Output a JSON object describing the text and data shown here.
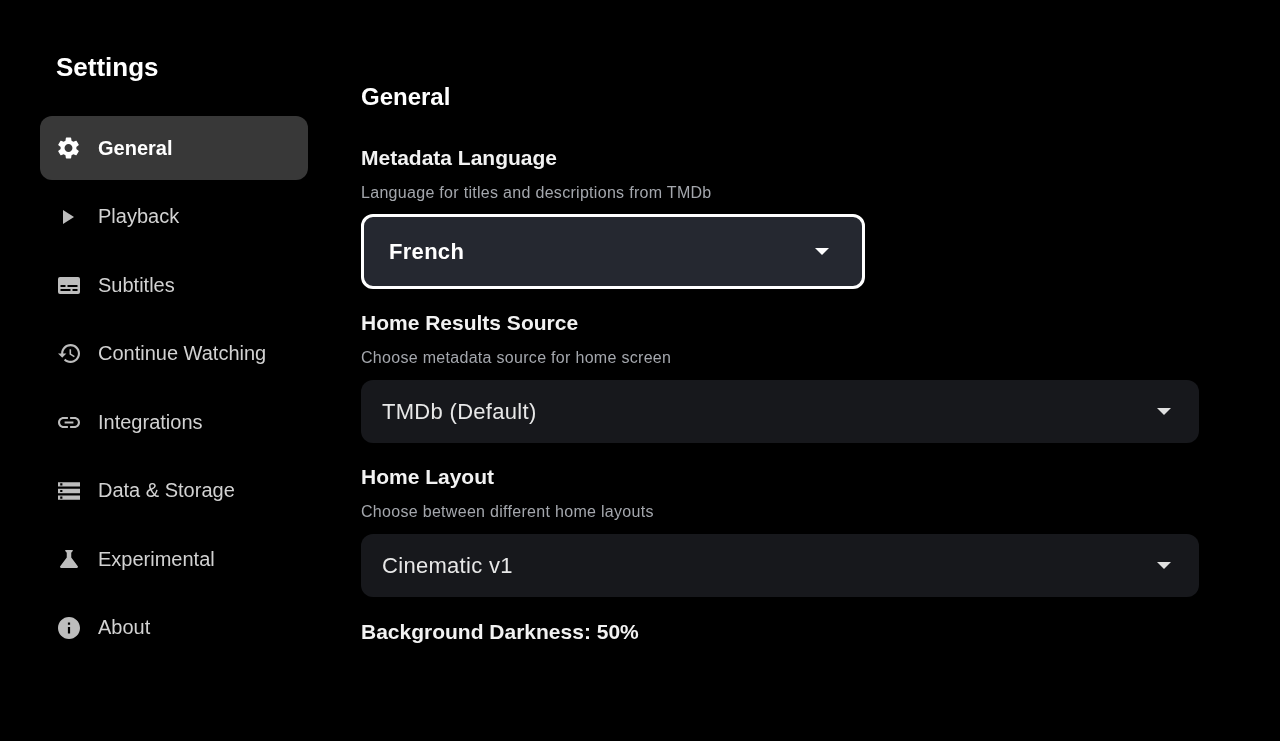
{
  "sidebar": {
    "title": "Settings",
    "items": [
      {
        "label": "General",
        "selected": true
      },
      {
        "label": "Playback",
        "selected": false
      },
      {
        "label": "Subtitles",
        "selected": false
      },
      {
        "label": "Continue Watching",
        "selected": false
      },
      {
        "label": "Integrations",
        "selected": false
      },
      {
        "label": "Data & Storage",
        "selected": false
      },
      {
        "label": "Experimental",
        "selected": false
      },
      {
        "label": "About",
        "selected": false
      }
    ]
  },
  "content": {
    "title": "General",
    "settings": [
      {
        "label": "Metadata Language",
        "description": "Language for titles and descriptions from TMDb",
        "value": "French",
        "focused": true
      },
      {
        "label": "Home Results Source",
        "description": "Choose metadata source for home screen",
        "value": "TMDb (Default)",
        "focused": false
      },
      {
        "label": "Home Layout",
        "description": "Choose between different home layouts",
        "value": "Cinematic v1",
        "focused": false
      }
    ],
    "last_setting": {
      "label": "Background Darkness: 50%"
    }
  }
}
